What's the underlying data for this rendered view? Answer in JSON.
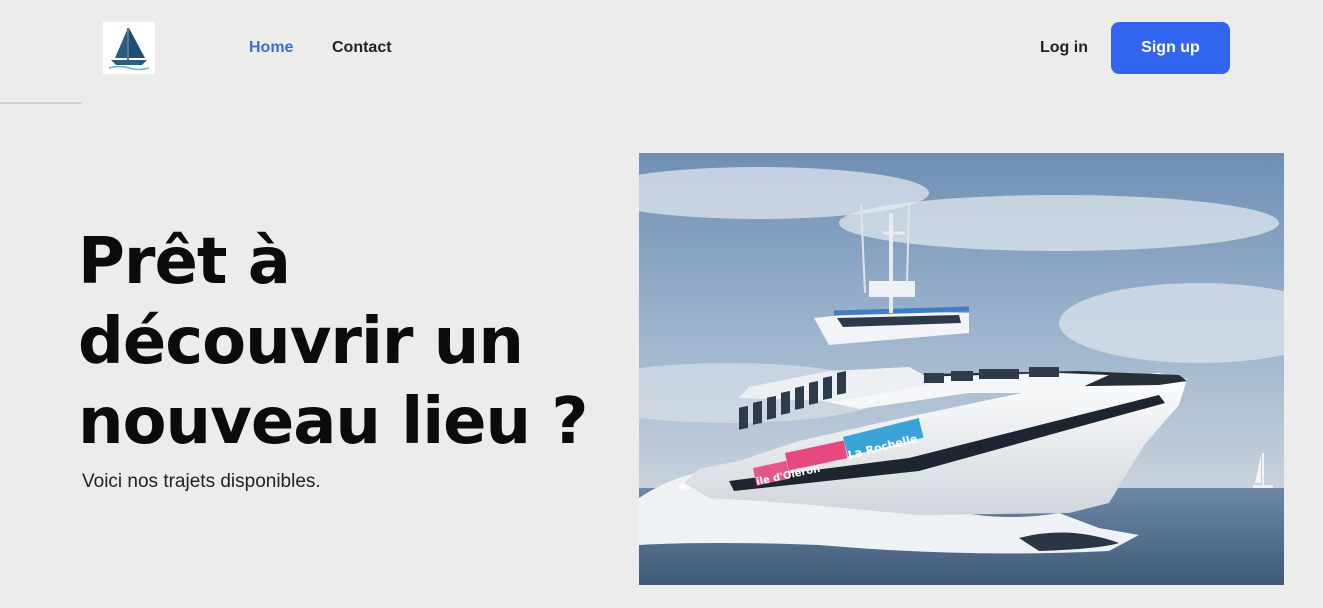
{
  "header": {
    "logo_icon": "sailboat-logo-icon",
    "nav": {
      "home_label": "Home",
      "contact_label": "Contact"
    },
    "login_label": "Log in",
    "signup_label": "Sign up",
    "colors": {
      "accent": "#3366f0",
      "active_nav": "#3a6fd8"
    }
  },
  "hero": {
    "title_line_1": "Prêt à",
    "title_line_2": "découvrir un",
    "title_line_3": "nouveau lieu ?",
    "subtitle": "Voici nos trajets disponibles.",
    "photo": {
      "icon": "ferry-boat-photo",
      "hull_text_1": "île d'Oléron",
      "hull_text_2": "La Rochelle"
    }
  }
}
